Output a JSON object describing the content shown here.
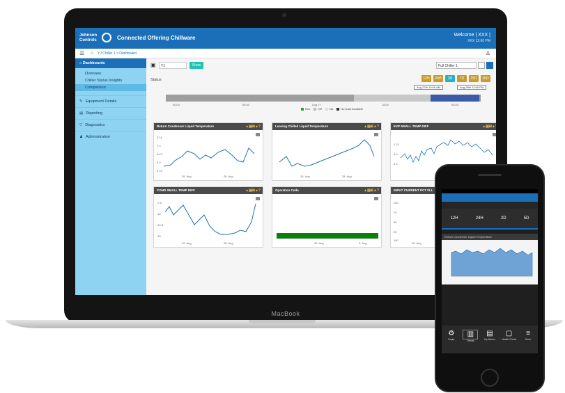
{
  "brand": {
    "laptop_label": "MacBook"
  },
  "app": {
    "logo_line1": "Johnson",
    "logo_line2": "Controls",
    "title": "Connected Offering Chillware",
    "welcome": "Welcome | XXX |",
    "welcome_sub": "XXX 12:00 PM"
  },
  "breadcrumb": {
    "path": "YJ Chiller 1  >  Dashboard"
  },
  "sidebar": {
    "active": "Dashboards",
    "sub_items": [
      "Overview",
      "Chiller Status Insights",
      "Comparison"
    ],
    "items": [
      {
        "label": "Equipment Details",
        "icon": "wrench-icon"
      },
      {
        "label": "Reporting",
        "icon": "chart-icon"
      },
      {
        "label": "Diagnostics",
        "icon": "filter-icon"
      },
      {
        "label": "Administration",
        "icon": "person-icon"
      }
    ]
  },
  "controls": {
    "asset_value": "Y1",
    "go_label": "Show",
    "range_value": "Full Chiller 1",
    "periods": [
      "12H",
      "24H",
      "3D",
      "7D",
      "15D",
      "30D"
    ],
    "selected_period": "3D"
  },
  "status": {
    "label": "Status",
    "tip_left": "Aug 27th 10:00 AM",
    "tip_right": "Aug 28th 12:00 PM",
    "ticks": [
      "00:00",
      "06:00",
      "Aug 27",
      "18:00",
      "06:00"
    ],
    "legend": [
      "Run",
      "Off",
      "NA",
      "No Data Available"
    ]
  },
  "panels": [
    {
      "title": "Return Condenser Liquid Temperature",
      "x_labels": [
        "26. Aug",
        "28. Aug"
      ],
      "y_labels": [
        "67.6",
        "7.0",
        "64.5",
        "6.0",
        "57.6"
      ]
    },
    {
      "title": "Leaving Chilled Liquid Temperature",
      "x_labels": [
        "26. Aug",
        "28. Aug"
      ],
      "y_labels": []
    },
    {
      "title": "EVP SMALL TEMP DIFF",
      "x_labels": [],
      "y_labels": [
        "1.21",
        "0.9",
        "0.4"
      ]
    },
    {
      "title": "COND SMALL TEMP DIFF",
      "x_labels": [
        "26. Aug",
        "28. Aug"
      ],
      "y_labels": [
        "-7.5",
        "-10",
        "-12.5",
        "-15"
      ]
    },
    {
      "title": "Operation Code",
      "x_labels": [
        "26. Aug",
        "3. Aug"
      ],
      "y_labels": []
    },
    {
      "title": "INPUT CURRENT PCT FLL",
      "x_labels": [
        "28. Aug"
      ],
      "y_labels": [
        "100",
        "75",
        "50",
        "25",
        "100"
      ]
    }
  ],
  "phone": {
    "ranges": [
      "12H",
      "24H",
      "2D",
      "5D"
    ],
    "card_title": "Return Condenser Liquid Temperature",
    "nav": [
      {
        "label": "Equip",
        "icon": "gear-icon"
      },
      {
        "label": "Trends",
        "icon": "bar-chart-icon"
      },
      {
        "label": "Hq Alarms",
        "icon": "list-icon"
      },
      {
        "label": "Health Check",
        "icon": "clipboard-icon"
      },
      {
        "label": "More",
        "icon": "menu-icon"
      }
    ]
  }
}
